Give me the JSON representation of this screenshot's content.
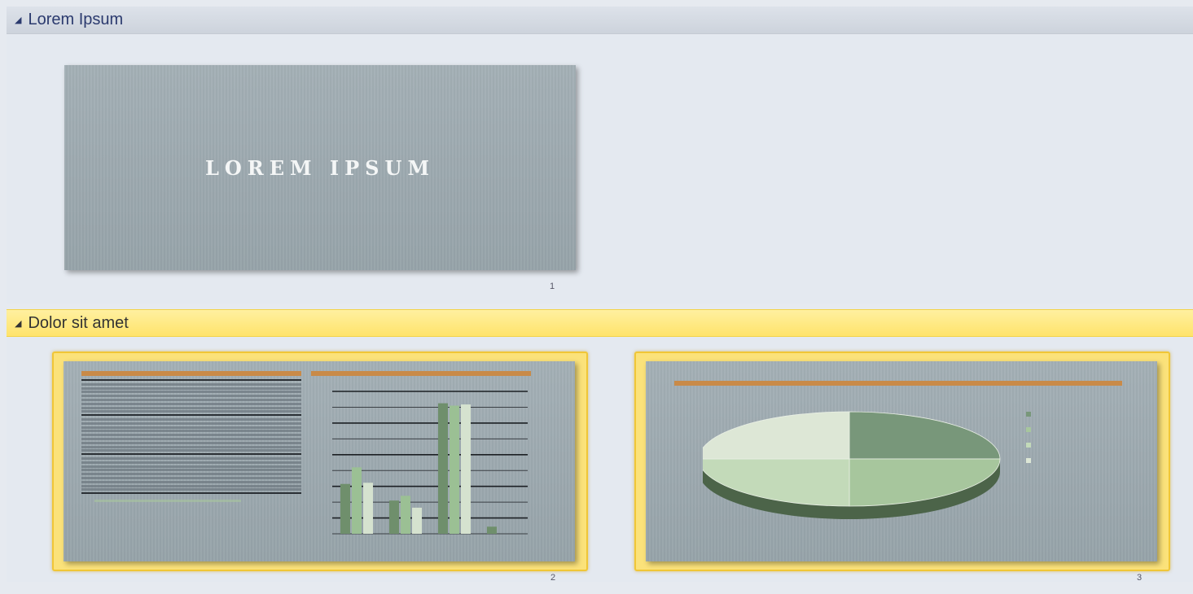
{
  "sections": [
    {
      "title": "Lorem Ipsum",
      "collapsed": false
    },
    {
      "title": "Dolor sit amet",
      "collapsed": false
    }
  ],
  "slides": [
    {
      "number": "1",
      "title": "LOREM IPSUM",
      "selected": false
    },
    {
      "number": "2",
      "selected": true
    },
    {
      "number": "3",
      "selected": true
    }
  ],
  "colors": {
    "selection": "#fbe27a",
    "accent_bar": "#c98a48",
    "slide_bg": "#9ba8ae"
  },
  "chart_data": [
    {
      "type": "bar",
      "categories": [
        "",
        "",
        "",
        ""
      ],
      "series": [
        {
          "values": [
            420,
            280,
            1100,
            60
          ]
        },
        {
          "values": [
            560,
            320,
            1080,
            0
          ]
        },
        {
          "values": [
            430,
            220,
            1090,
            0
          ]
        }
      ]
    },
    {
      "type": "pie",
      "values": [
        25,
        25,
        25,
        25
      ],
      "labels": [
        "",
        "",
        "",
        ""
      ]
    }
  ]
}
